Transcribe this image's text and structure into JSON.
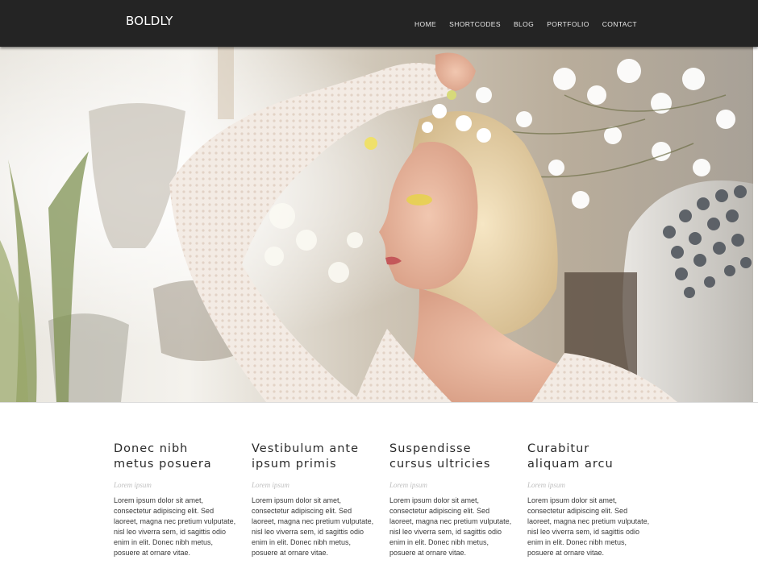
{
  "header": {
    "logo": "BOLDLY",
    "nav": [
      {
        "label": "HOME"
      },
      {
        "label": "SHORTCODES"
      },
      {
        "label": "BLOG"
      },
      {
        "label": "PORTFOLIO"
      },
      {
        "label": "CONTACT"
      }
    ]
  },
  "colors": {
    "header_bg": "#242424",
    "heading_text": "#2a2a2a",
    "subheading_text": "#c0c0c0",
    "body_text": "#3a3a3a"
  },
  "features": [
    {
      "title_line1": "Donec nibh",
      "title_line2": "metus posuera",
      "subtitle": "Lorem ipsum",
      "body": "Lorem ipsum dolor sit amet, consectetur adipiscing elit. Sed laoreet, magna nec pretium vulputate, nisl leo viverra sem, id sagittis odio enim in elit. Donec nibh metus, posuere at ornare vitae."
    },
    {
      "title_line1": "Vestibulum ante",
      "title_line2": "ipsum primis",
      "subtitle": "Lorem ipsum",
      "body": "Lorem ipsum dolor sit amet, consectetur adipiscing elit. Sed laoreet, magna nec pretium vulputate, nisl leo viverra sem, id sagittis odio enim in elit. Donec nibh metus, posuere at ornare vitae."
    },
    {
      "title_line1": "Suspendisse",
      "title_line2": "cursus ultricies",
      "subtitle": "Lorem ipsum",
      "body": "Lorem ipsum dolor sit amet, consectetur adipiscing elit. Sed laoreet, magna nec pretium vulputate, nisl leo viverra sem, id sagittis odio enim in elit. Donec nibh metus, posuere at ornare vitae."
    },
    {
      "title_line1": "Curabitur",
      "title_line2": "aliquam arcu",
      "subtitle": "Lorem ipsum",
      "body": "Lorem ipsum dolor sit amet, consectetur adipiscing elit. Sed laoreet, magna nec pretium vulputate, nisl leo viverra sem, id sagittis odio enim in elit. Donec nibh metus, posuere at ornare vitae."
    }
  ]
}
